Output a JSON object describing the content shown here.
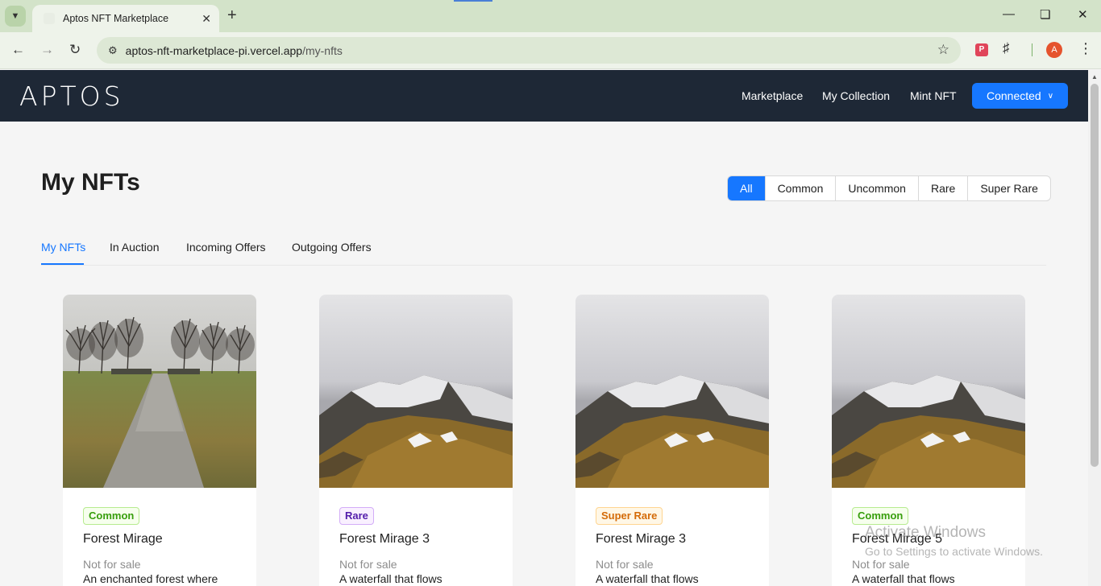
{
  "browser": {
    "tab_title": "Aptos NFT Marketplace",
    "url_host": "aptos-nft-marketplace-pi.vercel.app",
    "url_path": "/my-nfts",
    "avatar_letter": "A"
  },
  "navbar": {
    "logo": "APTOS",
    "links": [
      "Marketplace",
      "My Collection",
      "Mint NFT"
    ],
    "connect_label": "Connected"
  },
  "page": {
    "title": "My NFTs",
    "filters": [
      "All",
      "Common",
      "Uncommon",
      "Rare",
      "Super Rare"
    ],
    "active_filter": "All",
    "tabs": [
      "My NFTs",
      "In Auction",
      "Incoming Offers",
      "Outgoing Offers"
    ],
    "active_tab": "My NFTs"
  },
  "cards": [
    {
      "rarity": "Common",
      "name": "Forest Mirage",
      "status": "Not for sale",
      "description": "An enchanted forest where",
      "image": "forest-path"
    },
    {
      "rarity": "Rare",
      "name": "Forest Mirage 3",
      "status": "Not for sale",
      "description": "A waterfall that flows",
      "image": "snowy-mountain"
    },
    {
      "rarity": "Super Rare",
      "name": "Forest Mirage 3",
      "status": "Not for sale",
      "description": "A waterfall that flows",
      "image": "snowy-mountain"
    },
    {
      "rarity": "Common",
      "name": "Forest Mirage 5",
      "status": "Not for sale",
      "description": "A waterfall that flows",
      "image": "snowy-mountain"
    }
  ],
  "watermark": {
    "line1": "Activate Windows",
    "line2": "Go to Settings to activate Windows."
  },
  "colors": {
    "accent": "#1677ff",
    "navbar_bg": "#1e2836",
    "page_bg": "#f5f5f5"
  }
}
